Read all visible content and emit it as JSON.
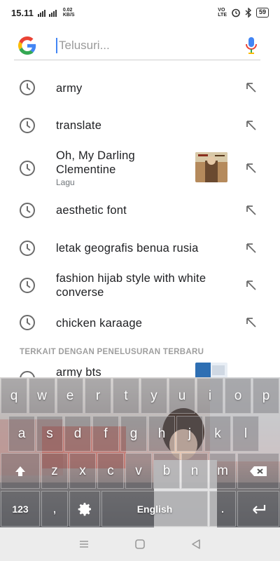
{
  "status": {
    "time": "15.11",
    "net_type": "4G",
    "data_speed_top": "0.02",
    "data_speed_bottom": "KB/S",
    "volte_top": "VO",
    "volte_bottom": "LTE",
    "battery": "59"
  },
  "search": {
    "placeholder": "Telusuri..."
  },
  "suggestions": [
    {
      "title": "army"
    },
    {
      "title": "translate"
    },
    {
      "title": "Oh, My Darling Clementine",
      "subtitle": "Lagu"
    },
    {
      "title": "aesthetic font"
    },
    {
      "title": "letak geografis benua rusia"
    },
    {
      "title": "fashion hijab style with white converse"
    },
    {
      "title": "chicken karaage"
    }
  ],
  "related_section_label": "TERKAIT DENGAN PENELUSURAN TERBARU",
  "related": [
    {
      "title": "army bts"
    }
  ],
  "keyboard": {
    "row1": [
      "q",
      "w",
      "e",
      "r",
      "t",
      "y",
      "u",
      "i",
      "o",
      "p"
    ],
    "row2": [
      "a",
      "s",
      "d",
      "f",
      "g",
      "h",
      "j",
      "k",
      "l"
    ],
    "row3": [
      "z",
      "x",
      "c",
      "v",
      "b",
      "n",
      "m"
    ],
    "num_key": "123",
    "comma_key": ",",
    "space_label": "English",
    "period_key": "."
  },
  "colors": {
    "accent_blue": "#4285f4",
    "icon_gray": "#5f6368"
  }
}
